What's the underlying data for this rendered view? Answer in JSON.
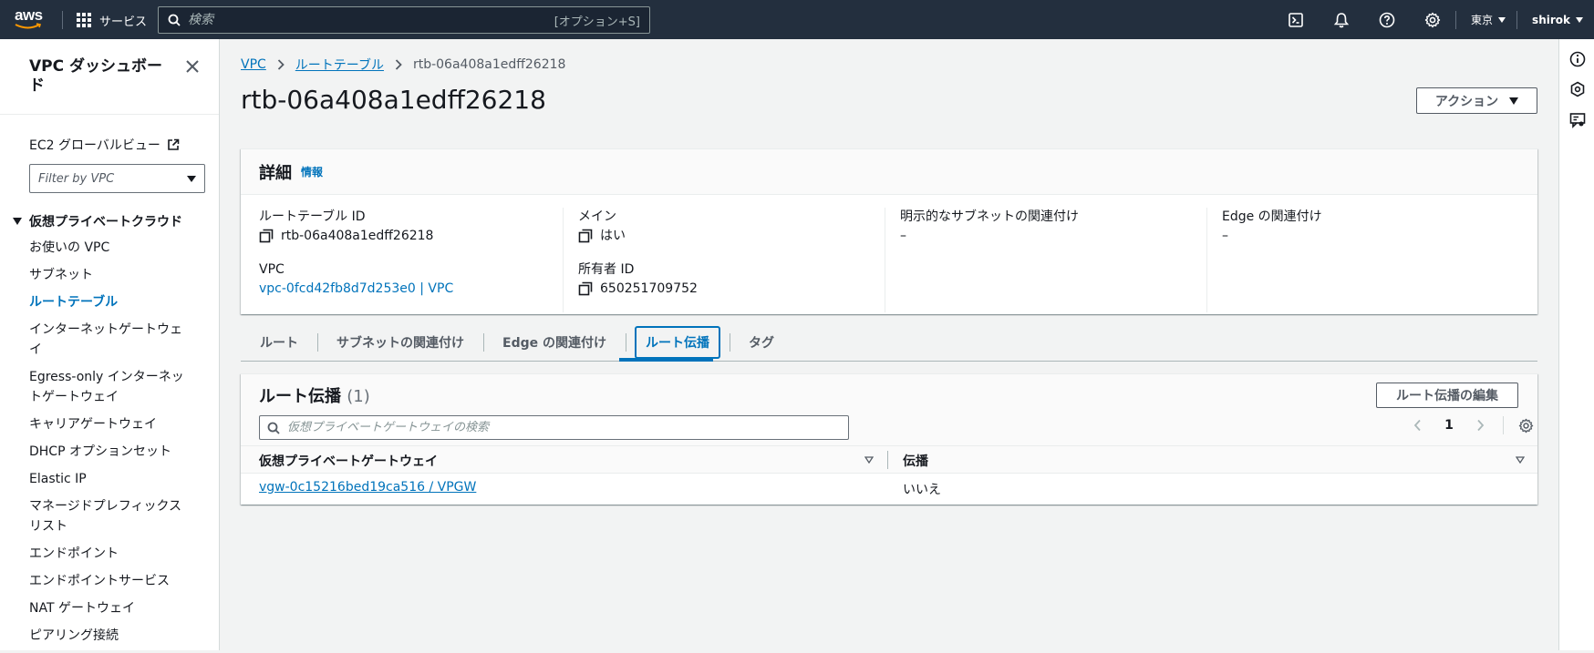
{
  "topbar": {
    "logo_text": "aws",
    "services_label": "サービス",
    "search_placeholder": "検索",
    "search_shortcut": "[オプション+S]",
    "region": "東京",
    "user": "shirok"
  },
  "sidebar": {
    "title": "VPC ダッシュボード",
    "ec2_link": "EC2 グローバルビュー",
    "filter_placeholder": "Filter by VPC",
    "section": "仮想プライベートクラウド",
    "items": [
      {
        "label": "お使いの VPC"
      },
      {
        "label": "サブネット"
      },
      {
        "label": "ルートテーブル"
      },
      {
        "label": "インターネットゲートウェイ"
      },
      {
        "label": "Egress-only インターネットゲートウェイ"
      },
      {
        "label": "キャリアゲートウェイ"
      },
      {
        "label": "DHCP オプションセット"
      },
      {
        "label": "Elastic IP"
      },
      {
        "label": "マネージドプレフィックスリスト"
      },
      {
        "label": "エンドポイント"
      },
      {
        "label": "エンドポイントサービス"
      },
      {
        "label": "NAT ゲートウェイ"
      },
      {
        "label": "ピアリング接続"
      }
    ]
  },
  "breadcrumb": {
    "items": [
      "VPC",
      "ルートテーブル"
    ],
    "current": "rtb-06a408a1edff26218"
  },
  "page": {
    "title": "rtb-06a408a1edff26218",
    "actions_label": "アクション"
  },
  "details": {
    "heading": "詳細",
    "info": "情報",
    "route_table_id_label": "ルートテーブル ID",
    "route_table_id": "rtb-06a408a1edff26218",
    "vpc_label": "VPC",
    "vpc_value": "vpc-0fcd42fb8d7d253e0 | VPC",
    "main_label": "メイン",
    "main_value": "はい",
    "owner_label": "所有者 ID",
    "owner_value": "650251709752",
    "explicit_subnet_label": "明示的なサブネットの関連付け",
    "explicit_subnet_value": "–",
    "edge_label": "Edge の関連付け",
    "edge_value": "–"
  },
  "tabs": [
    {
      "label": "ルート"
    },
    {
      "label": "サブネットの関連付け"
    },
    {
      "label": "Edge の関連付け"
    },
    {
      "label": "ルート伝播"
    },
    {
      "label": "タグ"
    }
  ],
  "propagation": {
    "title": "ルート伝播",
    "count": "(1)",
    "edit_label": "ルート伝播の編集",
    "search_placeholder": "仮想プライベートゲートウェイの検索",
    "page": "1",
    "columns": [
      "仮想プライベートゲートウェイ",
      "伝播"
    ],
    "rows": [
      {
        "gateway": "vgw-0c15216bed19ca516 / VPGW",
        "propagation": "いいえ"
      }
    ]
  }
}
